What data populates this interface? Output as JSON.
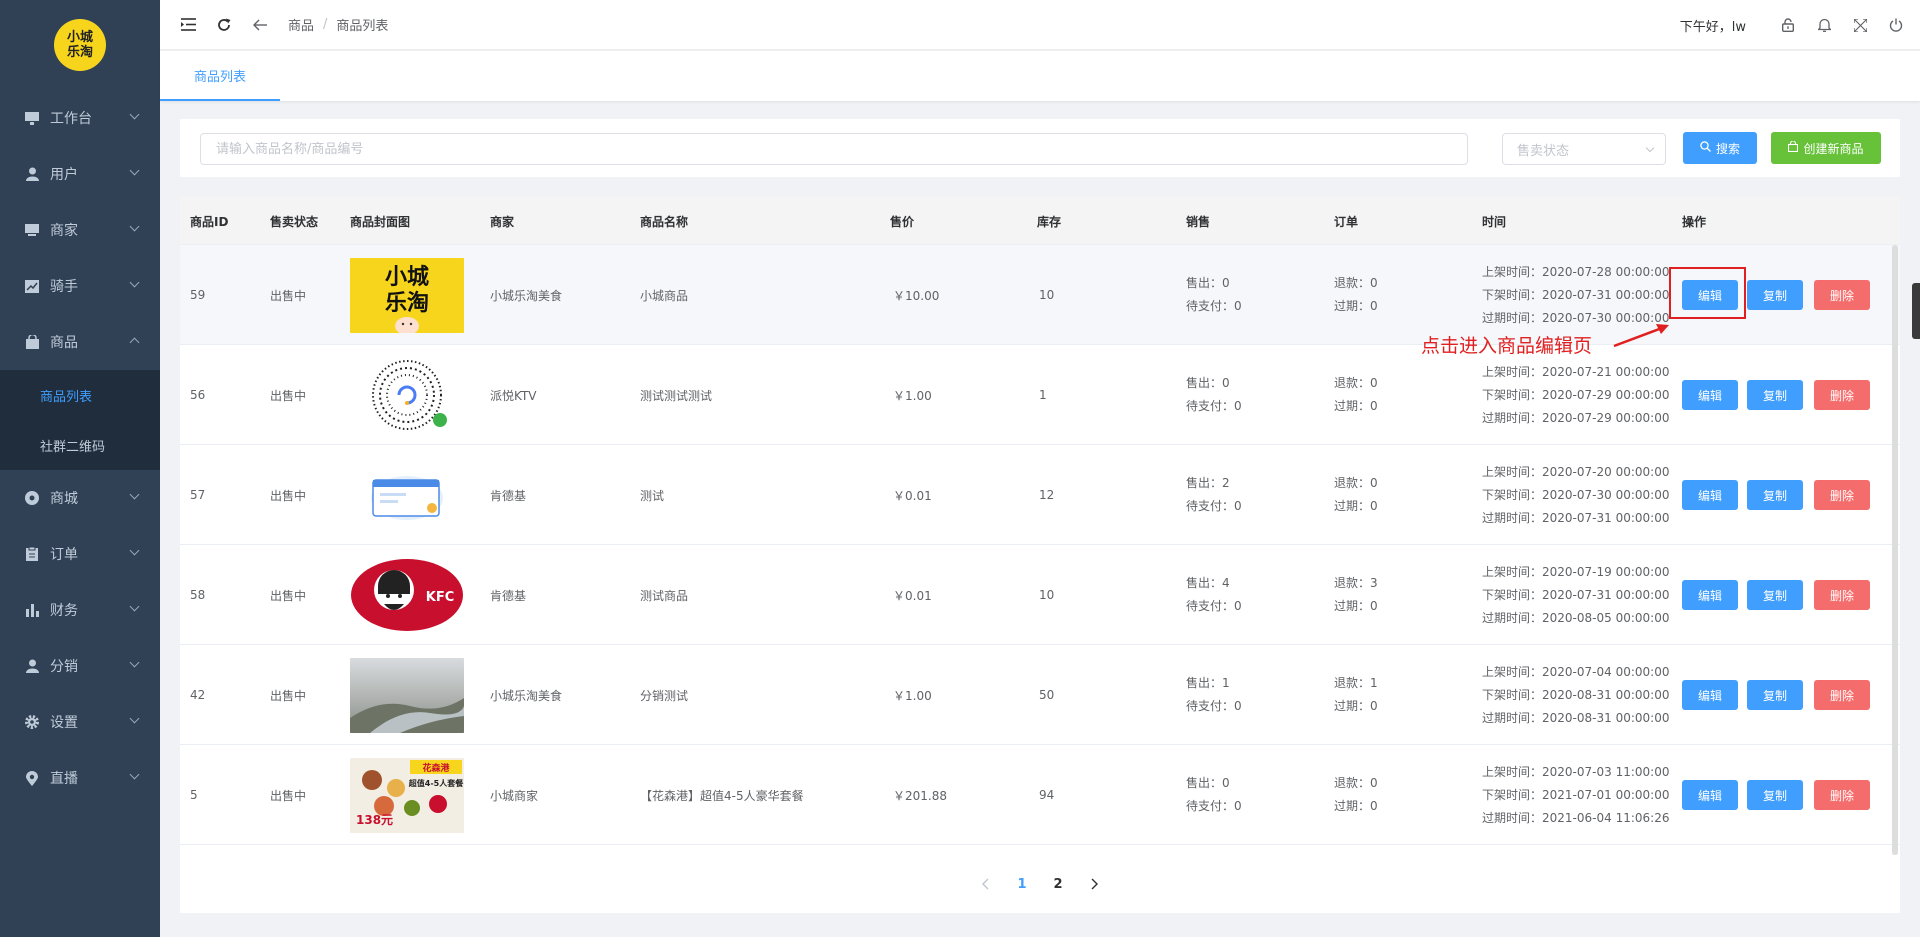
{
  "logo": {
    "line1": "小城",
    "line2": "乐淘"
  },
  "sidebar": {
    "items": [
      {
        "label": "工作台",
        "icon": "monitor-icon"
      },
      {
        "label": "用户",
        "icon": "user-icon"
      },
      {
        "label": "商家",
        "icon": "store-icon"
      },
      {
        "label": "骑手",
        "icon": "chart-icon"
      },
      {
        "label": "商品",
        "icon": "bag-icon"
      },
      {
        "label": "商城",
        "icon": "globe-icon"
      },
      {
        "label": "订单",
        "icon": "clipboard-icon"
      },
      {
        "label": "财务",
        "icon": "bar-chart-icon"
      },
      {
        "label": "分销",
        "icon": "user-icon"
      },
      {
        "label": "设置",
        "icon": "gear-icon"
      },
      {
        "label": "直播",
        "icon": "location-icon"
      }
    ],
    "goods_sub": [
      {
        "label": "商品列表"
      },
      {
        "label": "社群二维码"
      }
    ]
  },
  "header": {
    "breadcrumb": [
      "商品",
      "商品列表"
    ],
    "greeting": "下午好，lw"
  },
  "tabs": [
    {
      "label": "商品列表"
    }
  ],
  "search": {
    "placeholder": "请输入商品名称/商品编号",
    "status_placeholder": "售卖状态",
    "search_label": "搜索",
    "create_label": "创建新商品"
  },
  "table": {
    "columns": [
      "商品ID",
      "售卖状态",
      "商品封面图",
      "商家",
      "商品名称",
      "售价",
      "库存",
      "销售",
      "订单",
      "时间",
      "操作"
    ],
    "sold_label": "售出：",
    "unpaid_label": "待支付：",
    "refund_label": "退款：",
    "expired_label": "过期：",
    "on_label": "上架时间：",
    "off_label": "下架时间：",
    "exp_label": "过期时间：",
    "edit_label": "编辑",
    "copy_label": "复制",
    "delete_label": "删除",
    "rows": [
      {
        "id": "59",
        "status": "出售中",
        "merchant": "小城乐淘美食",
        "name": "小城商品",
        "price": "￥10.00",
        "stock": "10",
        "sold": "0",
        "unpaid": "0",
        "refund": "0",
        "expired": "0",
        "on": "2020-07-28 00:00:00",
        "off": "2020-07-31 00:00:00",
        "exp": "2020-07-30 00:00:00"
      },
      {
        "id": "56",
        "status": "出售中",
        "merchant": "派悦KTV",
        "name": "测试测试测试",
        "price": "￥1.00",
        "stock": "1",
        "sold": "0",
        "unpaid": "0",
        "refund": "0",
        "expired": "0",
        "on": "2020-07-21 00:00:00",
        "off": "2020-07-29 00:00:00",
        "exp": "2020-07-29 00:00:00"
      },
      {
        "id": "57",
        "status": "出售中",
        "merchant": "肯德基",
        "name": "测试",
        "price": "￥0.01",
        "stock": "12",
        "sold": "2",
        "unpaid": "0",
        "refund": "0",
        "expired": "0",
        "on": "2020-07-20 00:00:00",
        "off": "2020-07-30 00:00:00",
        "exp": "2020-07-31 00:00:00"
      },
      {
        "id": "58",
        "status": "出售中",
        "merchant": "肯德基",
        "name": "测试商品",
        "price": "￥0.01",
        "stock": "10",
        "sold": "4",
        "unpaid": "0",
        "refund": "3",
        "expired": "0",
        "on": "2020-07-19 00:00:00",
        "off": "2020-07-31 00:00:00",
        "exp": "2020-08-05 00:00:00"
      },
      {
        "id": "42",
        "status": "出售中",
        "merchant": "小城乐淘美食",
        "name": "分销测试",
        "price": "￥1.00",
        "stock": "50",
        "sold": "1",
        "unpaid": "0",
        "refund": "1",
        "expired": "0",
        "on": "2020-07-04 00:00:00",
        "off": "2020-08-31 00:00:00",
        "exp": "2020-08-31 00:00:00"
      },
      {
        "id": "5",
        "status": "出售中",
        "merchant": "小城商家",
        "name": "【花森港】超值4-5人豪华套餐",
        "price": "￥201.88",
        "stock": "94",
        "sold": "0",
        "unpaid": "0",
        "refund": "0",
        "expired": "0",
        "on": "2020-07-03 11:00:00",
        "off": "2021-07-01 00:00:00",
        "exp": "2021-06-04 11:06:26"
      }
    ]
  },
  "thumb_text": {
    "logo_line1": "小城",
    "logo_line2": "乐淘",
    "kfc": "KFC",
    "promo_top": "花森港",
    "promo_mid": "超值4-5人套餐",
    "promo_price": "138元"
  },
  "annotation": {
    "text": "点击进入商品编辑页"
  },
  "pagination": {
    "pages": [
      "1",
      "2"
    ],
    "current": "1"
  },
  "colors": {
    "sidebar": "#304156",
    "primary": "#409eff",
    "success": "#67c23a",
    "danger": "#f56c6c",
    "annotation": "#e02020"
  }
}
